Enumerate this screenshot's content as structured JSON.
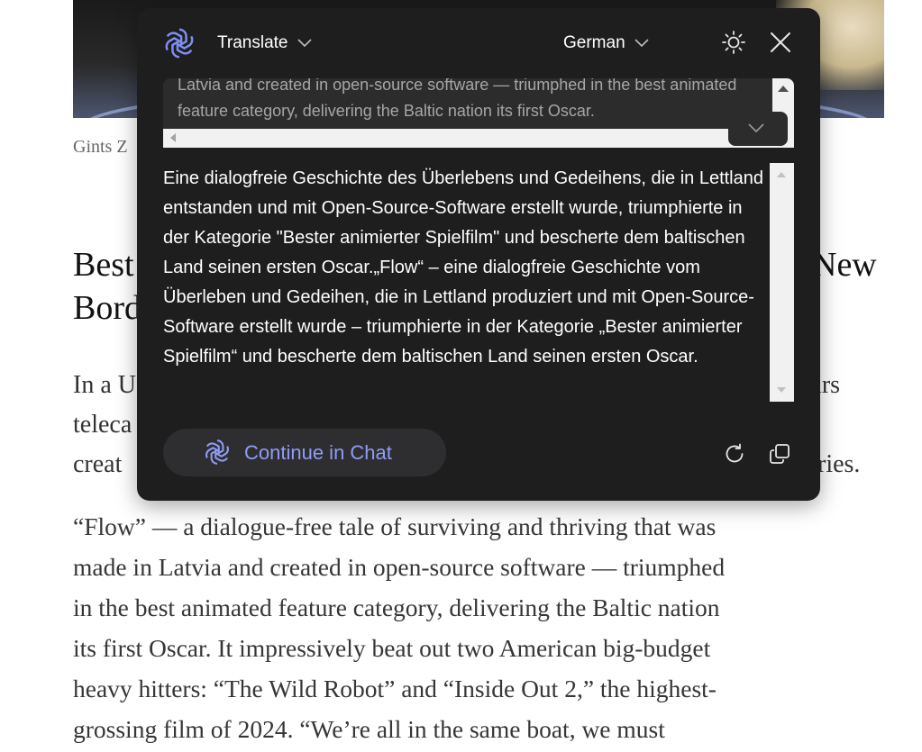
{
  "article": {
    "photo_credit": "Gints Z",
    "headline_line1_left": "Best",
    "headline_line1_right": "New",
    "headline_line2_left": "Bord",
    "intro_line1_left": "In a U",
    "intro_line1_right": "cars",
    "intro_line2_left": "teleca",
    "intro_line3_left": "creat",
    "intro_line3_right": "ries.",
    "body_lines": [
      "“Flow” — a dialogue-free tale of surviving and thriving that was",
      "made in Latvia and created in open-source software — triumphed",
      "in the best animated feature category, delivering the Baltic nation",
      "its first Oscar. It impressively beat out two American big-budget",
      "heavy hitters: “The Wild Robot” and “Inside Out 2,” the highest-",
      "grossing film of 2024. “We’re all in the same boat, we must"
    ]
  },
  "popup": {
    "mode_label": "Translate",
    "target_language": "German",
    "source_text": "Latvia and created in open-source software — triumphed in the best animated feature category, delivering the Baltic nation its first Oscar.",
    "translated_text": "Eine dialogfreie Geschichte des Überlebens und Gedeihens, die in Lettland entstanden und mit Open-Source-Software erstellt wurde, triumphierte in der Kategorie \"Bester animierter Spielfilm\" und bescherte dem baltischen Land seinen ersten Oscar.„Flow“ – eine dialogfreie Geschichte vom Überleben und Gedeihen, die in Lettland produziert und mit Open-Source-Software erstellt wurde – triumphierte in der Kategorie „Bester animierter Spielfilm“ und bescherte dem baltischen Land seinen ersten Oscar.",
    "continue_label": "Continue in Chat",
    "icons": {
      "logo": "openai-logo-icon",
      "mode_chevron": "chevron-down-icon",
      "language_chevron": "chevron-down-icon",
      "theme": "sun-icon",
      "close": "close-icon",
      "expand": "chevron-down-icon",
      "refresh": "refresh-icon",
      "copy": "copy-icon"
    },
    "colors": {
      "background": "#1e1e1f",
      "accent": "#8f9cf5",
      "source_text": "#a6a6a6"
    }
  }
}
